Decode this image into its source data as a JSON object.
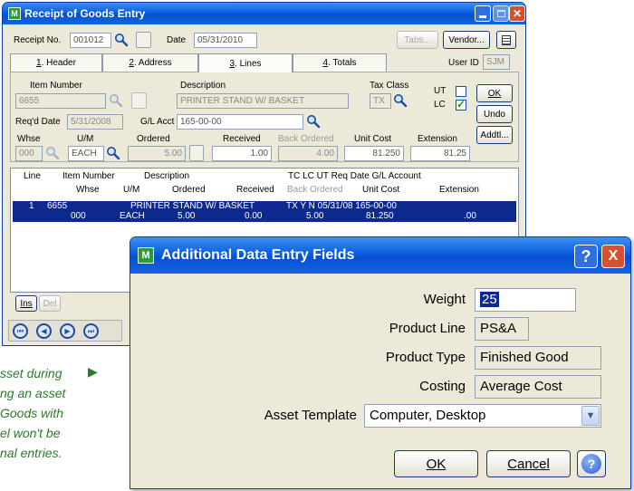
{
  "main_window": {
    "title": "Receipt of Goods Entry",
    "receipt_no_label": "Receipt No.",
    "receipt_no": "001012",
    "date_label": "Date",
    "date": "05/31/2010",
    "tabs_button": "Tabs...",
    "vendor_button": "Vendor...",
    "user_id_label": "User ID",
    "user_id": "SJM",
    "tabs": [
      {
        "num": "1",
        "label": ". Header"
      },
      {
        "num": "2",
        "label": ". Address"
      },
      {
        "num": "3",
        "label": ". Lines"
      },
      {
        "num": "4",
        "label": ". Totals"
      }
    ],
    "item_number_label": "Item Number",
    "item_number": "6655",
    "description_label": "Description",
    "description": "PRINTER STAND W/ BASKET",
    "tax_class_label": "Tax Class",
    "tax_class": "TX",
    "ut_label": "UT",
    "lc_label": "LC",
    "reqd_date_label": "Req'd Date",
    "reqd_date": "5/31/2008",
    "gl_acct_label": "G/L Acct",
    "gl_acct": "165-00-00",
    "whse_label": "Whse",
    "whse": "000",
    "um_label": "U/M",
    "um": "EACH",
    "ordered_label": "Ordered",
    "ordered": "5.00",
    "received_label": "Received",
    "received": "1.00",
    "back_ordered_label": "Back Ordered",
    "back_ordered": "4.00",
    "unit_cost_label": "Unit Cost",
    "unit_cost": "81.250",
    "extension_label": "Extension",
    "extension": "81.25",
    "ok_button": "OK",
    "undo_button": "Undo",
    "addtl_button": "Addtl...",
    "grid": {
      "headers_row1": {
        "line": "Line",
        "item": "Item Number",
        "desc": "Description",
        "tc": "TC LC UT Req Date  G/L Account"
      },
      "headers_row2": {
        "whse": "Whse",
        "um": "U/M",
        "ordered": "Ordered",
        "received": "Received",
        "back_ordered": "Back Ordered",
        "unit_cost": "Unit Cost",
        "extension": "Extension"
      },
      "row": {
        "line": "1",
        "item": "6655",
        "desc": "PRINTER STAND W/ BASKET",
        "tc": "TX  Y  N  05/31/08  165-00-00",
        "whse": "000",
        "um": "EACH",
        "ordered": "5.00",
        "received": "0.00",
        "back_ordered": "5.00",
        "unit_cost": "81.250",
        "extension": ".00"
      }
    },
    "ins_button": "Ins",
    "del_button": "Del"
  },
  "dialog": {
    "title": "Additional Data Entry Fields",
    "help_glyph": "?",
    "close_glyph": "X",
    "weight_label": "Weight",
    "weight": "25",
    "product_line_label": "Product Line",
    "product_line": "PS&A",
    "product_type_label": "Product Type",
    "product_type": "Finished Good",
    "costing_label": "Costing",
    "costing": "Average Cost",
    "asset_template_label": "Asset Template",
    "asset_template": "Computer, Desktop",
    "ok_button": "OK",
    "cancel_button": "Cancel"
  },
  "side_text": {
    "line1": "sset during",
    "line2": "ng an asset",
    "line3": "Goods with",
    "line4": "el won't be",
    "line5": "nal entries."
  },
  "colors": {
    "title_blue": "#0a5fe0",
    "window_face": "#ece9d8",
    "selection": "#0c2a8e",
    "accent_green": "#2b7a2b"
  }
}
